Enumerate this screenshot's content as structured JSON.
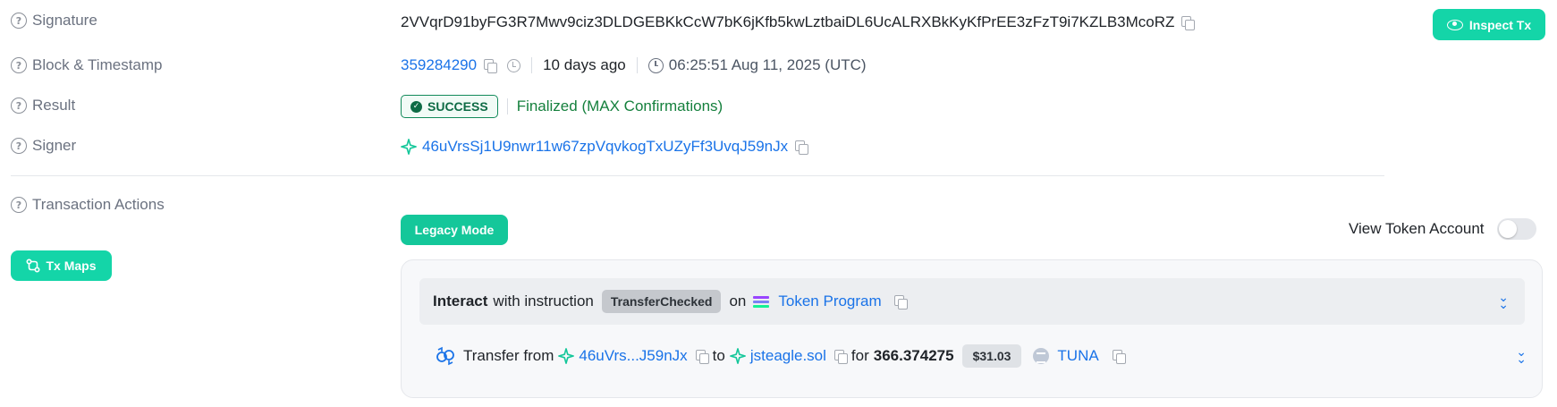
{
  "signature": {
    "label": "Signature",
    "value": "2VVqrD91byFG3R7Mwv9ciz3DLDGEBKkCcW7bK6jKfb5kwLztbaiDL6UcALRXBkKyKfPrEE3zFzT9i7KZLB3McoRZ",
    "inspect_label": "Inspect Tx"
  },
  "block": {
    "label": "Block & Timestamp",
    "number": "359284290",
    "relative": "10 days ago",
    "timestamp": "06:25:51 Aug 11, 2025 (UTC)"
  },
  "result": {
    "label": "Result",
    "badge": "SUCCESS",
    "status": "Finalized (MAX Confirmations)"
  },
  "signer": {
    "label": "Signer",
    "address": "46uVrsSj1U9nwr11w67zpVqvkogTxUZyFf3UvqJ59nJx"
  },
  "actions": {
    "label": "Transaction Actions",
    "tx_maps": "Tx Maps",
    "legacy_mode": "Legacy Mode",
    "view_token_account": "View Token Account",
    "instruction": {
      "verb": "Interact",
      "with_text": "with instruction",
      "name": "TransferChecked",
      "on_text": "on",
      "program": "Token Program"
    },
    "transfer": {
      "transfer_text": "Transfer from",
      "from": "46uVrs...J59nJx",
      "to_text": "to",
      "to": "jsteagle.sol",
      "for_text": "for",
      "amount": "366.374275",
      "usd": "$31.03",
      "token": "TUNA"
    }
  },
  "colors": {
    "accent": "#14d5a8",
    "link": "#1a73e8",
    "success": "#15803d"
  }
}
